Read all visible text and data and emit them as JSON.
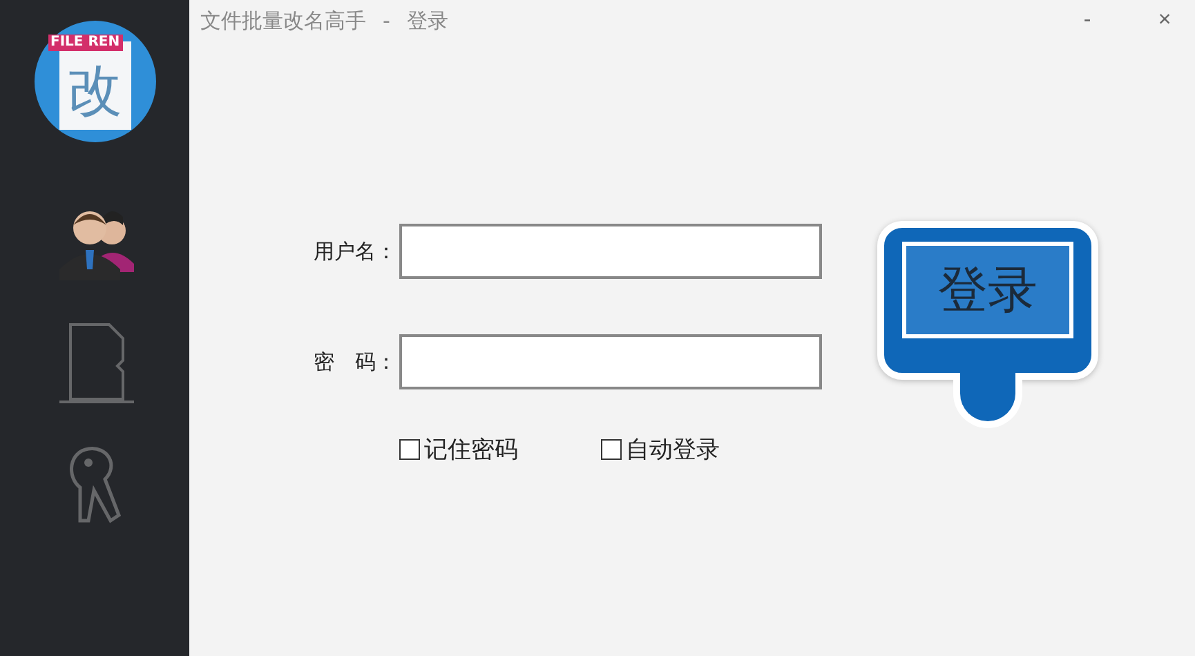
{
  "sidebar": {
    "logo": {
      "badge": "FILE REN",
      "glyph": "改"
    },
    "items": [
      {
        "kind": "users"
      },
      {
        "kind": "document"
      },
      {
        "kind": "key"
      }
    ]
  },
  "window": {
    "title": "文件批量改名高手",
    "separator": "-",
    "subtitle": "登录",
    "controls": [
      "-",
      "×"
    ]
  },
  "form": {
    "fields": [
      {
        "label": "用户名："
      },
      {
        "label": "密　码："
      }
    ],
    "checkboxes": [
      {
        "label": "记住密码",
        "checked": false
      },
      {
        "label": "自动登录",
        "checked": false
      }
    ],
    "login_button": "登录"
  }
}
